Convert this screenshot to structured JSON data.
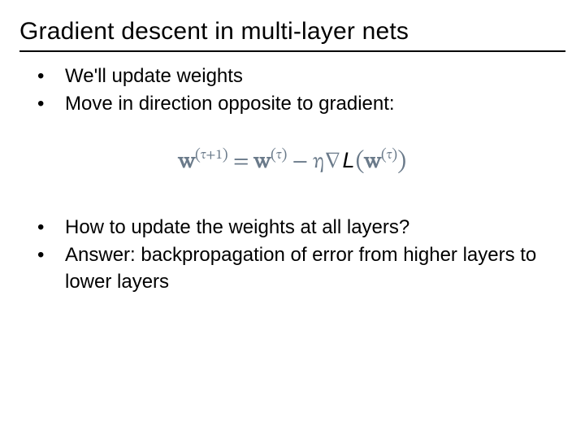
{
  "title": "Gradient descent in multi-layer nets",
  "bullets_top": [
    "We'll update weights",
    "Move in direction opposite to gradient:"
  ],
  "equation": {
    "w": "w",
    "lparen": "(",
    "rparen": ")",
    "tau": "τ",
    "tau_plus_1": "τ+1",
    "eq": " = ",
    "minus": " − ",
    "eta": "η",
    "nabla": "∇",
    "L": "L"
  },
  "bullets_bottom": [
    "How to update the weights at all layers?",
    "Answer: backpropagation of error from higher layers to lower layers"
  ]
}
